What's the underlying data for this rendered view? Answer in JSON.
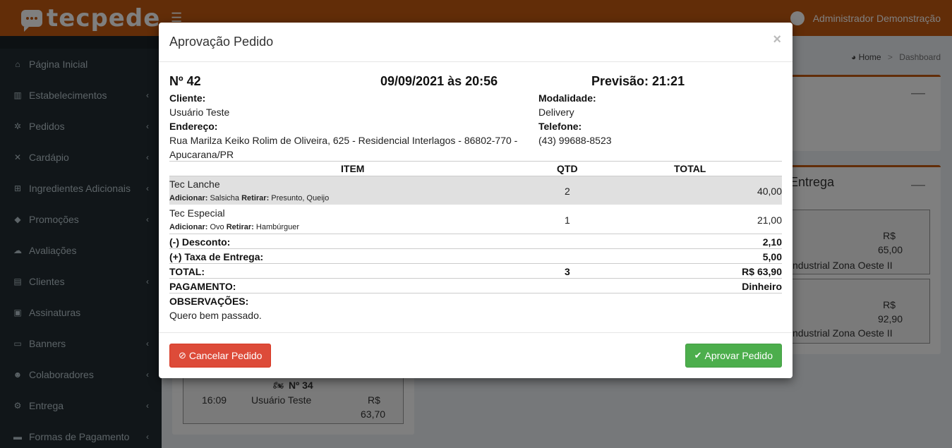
{
  "header": {
    "logo_text": "tecpede",
    "menu_icon": "☰",
    "admin_name": "Administrador Demonstração"
  },
  "sidebar": {
    "items": [
      {
        "label": "Página Inicial",
        "icon": "⌂",
        "chevron": ""
      },
      {
        "label": "Estabelecimentos",
        "icon": "▥",
        "chevron": "‹"
      },
      {
        "label": "Pedidos",
        "icon": "✲",
        "chevron": "‹"
      },
      {
        "label": "Cardápio",
        "icon": "✕",
        "chevron": "‹"
      },
      {
        "label": "Ingredientes Adicionais",
        "icon": "⊞",
        "chevron": "‹"
      },
      {
        "label": "Promoções",
        "icon": "◆",
        "chevron": "‹"
      },
      {
        "label": "Avaliações",
        "icon": "☁",
        "chevron": ""
      },
      {
        "label": "Clientes",
        "icon": "▤",
        "chevron": "‹"
      },
      {
        "label": "Assinaturas",
        "icon": "▣",
        "chevron": ""
      },
      {
        "label": "Banners",
        "icon": "▭",
        "chevron": "‹"
      },
      {
        "label": "Colaboradores",
        "icon": "☻",
        "chevron": "‹"
      },
      {
        "label": "Entrega",
        "icon": "⚙",
        "chevron": "‹"
      },
      {
        "label": "Formas de Pagamento",
        "icon": "▬",
        "chevron": "‹"
      }
    ]
  },
  "breadcrumb": {
    "home": "Home",
    "sep": ">",
    "current": "Dashboard"
  },
  "background": {
    "entrega_title": "Entrega",
    "minimize": "—",
    "cards": [
      {
        "rs": "R$",
        "value": "65,00",
        "address": "ndustrial Zona Oeste II"
      },
      {
        "rs": "R$",
        "value": "92,90",
        "address": "ndustrial Zona Oeste II"
      }
    ],
    "bottom_card": {
      "icon": "🏍",
      "number": "Nº 34",
      "time": "16:09",
      "client": "Usuário Teste",
      "rs": "R$",
      "value": "63,70"
    }
  },
  "modal": {
    "title": "Aprovação Pedido",
    "close": "×",
    "order_number": "Nº 42",
    "datetime": "09/09/2021 às 20:56",
    "forecast": "Previsão: 21:21",
    "client_label": "Cliente:",
    "client_value": "Usuário Teste",
    "address_label": "Endereço:",
    "address_line1": "Rua Marilza Keiko Rolim de Oliveira, 625 - Residencial Interlagos - 86802-770 -",
    "address_line2": "Apucarana/PR",
    "mode_label": "Modalidade:",
    "mode_value": "Delivery",
    "phone_label": "Telefone:",
    "phone_value": "(43) 99688-8523",
    "table_headers": {
      "item": "ITEM",
      "qty": "QTD",
      "total": "TOTAL"
    },
    "items": [
      {
        "name": "Tec Lanche",
        "add_label": "Adicionar:",
        "add_value": "Salsicha",
        "rem_label": "Retirar:",
        "rem_value": "Presunto, Queijo",
        "qty": "2",
        "total": "40,00"
      },
      {
        "name": "Tec Especial",
        "add_label": "Adicionar:",
        "add_value": "Ovo",
        "rem_label": "Retirar:",
        "rem_value": "Hambúrguer",
        "qty": "1",
        "total": "21,00"
      }
    ],
    "discount_label": "(-) Desconto:",
    "discount_value": "2,10",
    "fee_label": "(+) Taxa de Entrega:",
    "fee_value": "5,00",
    "total_label": "TOTAL:",
    "total_qty": "3",
    "total_value": "R$ 63,90",
    "payment_label": "PAGAMENTO:",
    "payment_value": "Dinheiro",
    "notes_label": "OBSERVAÇÕES:",
    "notes_value": "Quero bem passado.",
    "cancel_label": "Cancelar Pedido",
    "approve_label": "Aprovar Pedido",
    "cancel_icon": "⊘",
    "approve_icon": "✔"
  },
  "colors": {
    "brand": "#c55a11",
    "sidebar": "#222d32",
    "danger": "#dd4b39",
    "success": "#4cae4c"
  }
}
